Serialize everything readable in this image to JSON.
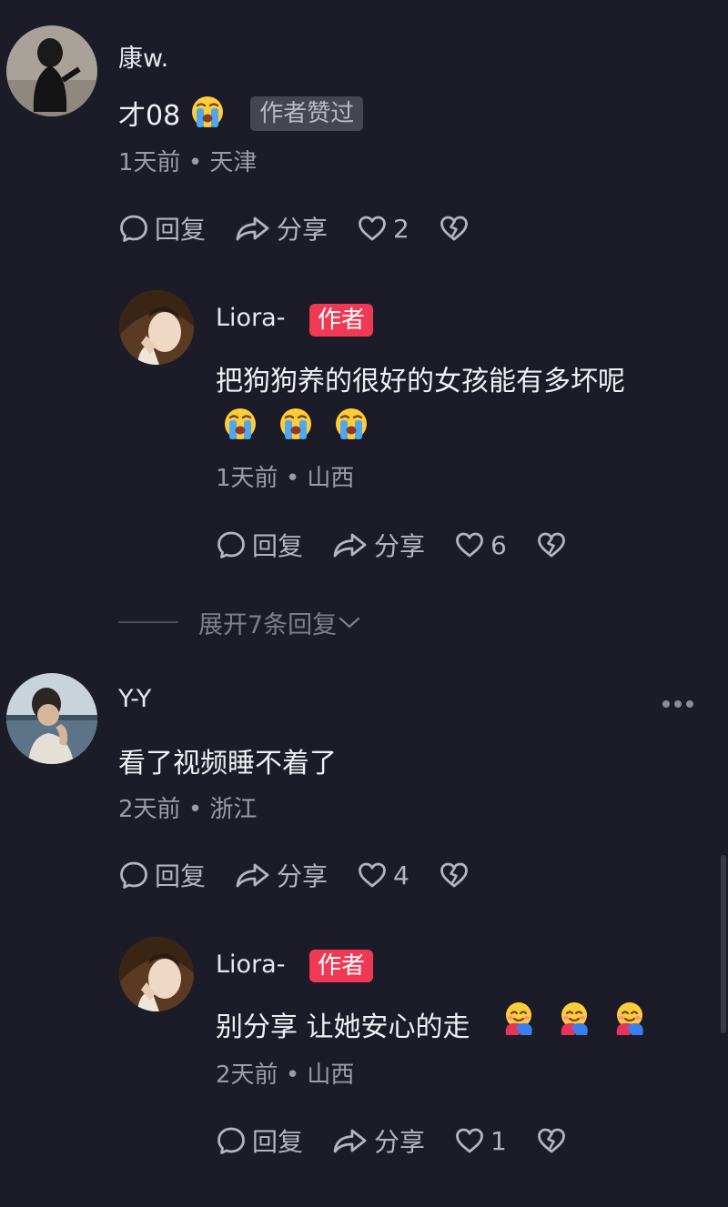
{
  "comments": [
    {
      "name": "康w.",
      "text": "才08",
      "liked_by_author": "作者赞过",
      "time": "1天前",
      "location": "天津",
      "reply_label": "回复",
      "share_label": "分享",
      "likes": "2"
    },
    {
      "name": "Liora-",
      "badge": "作者",
      "text": "把狗狗养的很好的女孩能有多坏呢",
      "time": "1天前",
      "location": "山西",
      "reply_label": "回复",
      "share_label": "分享",
      "likes": "6"
    },
    {
      "name": "Y-Y",
      "text": "看了视频睡不着了",
      "time": "2天前",
      "location": "浙江",
      "reply_label": "回复",
      "share_label": "分享",
      "likes": "4"
    },
    {
      "name": "Liora-",
      "badge": "作者",
      "text": "别分享 让她安心的走",
      "time": "2天前",
      "location": "山西",
      "reply_label": "回复",
      "share_label": "分享",
      "likes": "1"
    }
  ],
  "expand_replies": "展开7条回复",
  "meta_separator": "•",
  "colors": {
    "background": "#1b1c28",
    "author_badge": "#f03a55",
    "liked_badge_bg": "#45464f",
    "secondary_text": "#9b9ca5"
  },
  "icons": [
    "reply-bubble-icon",
    "share-arrow-icon",
    "heart-icon",
    "broken-heart-icon",
    "crying-emoji",
    "hugging-emoji",
    "more-dots-icon",
    "chevron-down-icon"
  ]
}
